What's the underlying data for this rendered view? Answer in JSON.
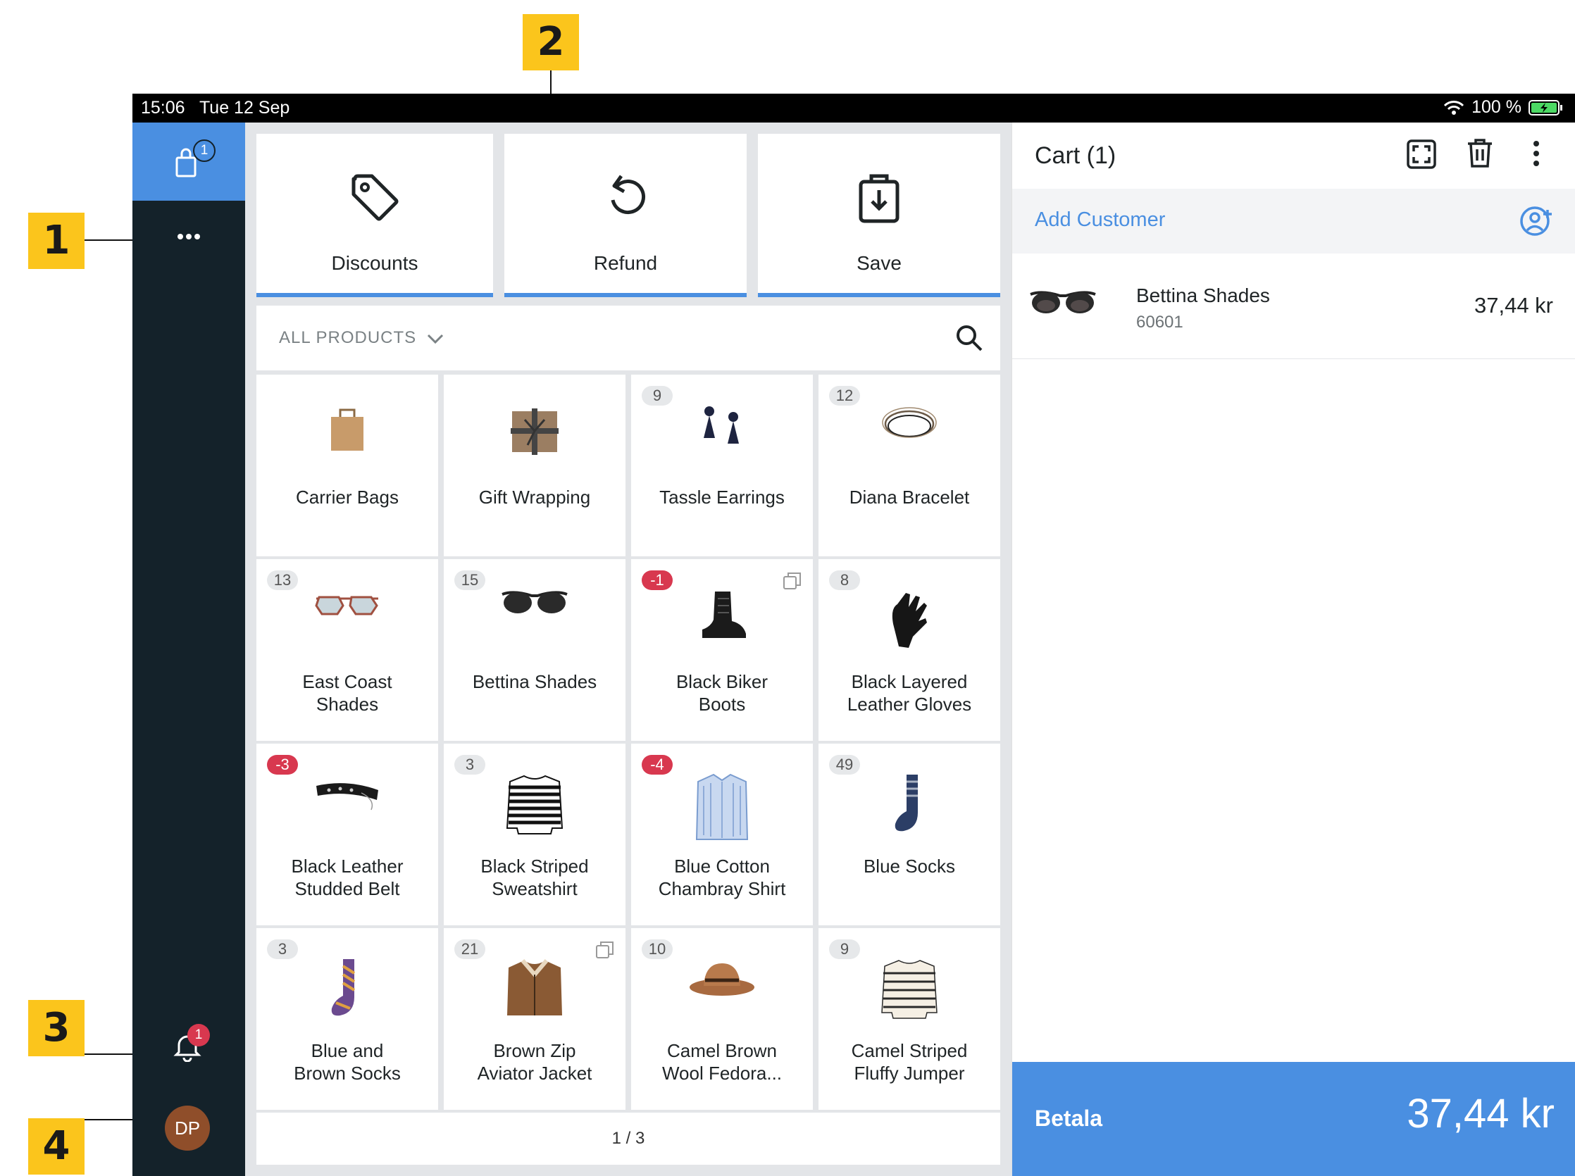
{
  "callouts": [
    "1",
    "2",
    "3",
    "4"
  ],
  "status_bar": {
    "time": "15:06",
    "date": "Tue 12 Sep",
    "battery": "100 %"
  },
  "sidebar": {
    "cart_count": "1",
    "more_icon": "more-horizontal-icon",
    "notification_count": "1",
    "avatar_initials": "DP"
  },
  "actions": [
    {
      "label": "Discounts",
      "icon": "tag-icon"
    },
    {
      "label": "Refund",
      "icon": "refund-icon"
    },
    {
      "label": "Save",
      "icon": "save-bag-icon"
    }
  ],
  "filter": {
    "label": "ALL PRODUCTS"
  },
  "products": [
    {
      "name_1": "Carrier Bags",
      "name_2": "",
      "badge": "",
      "img": "bag"
    },
    {
      "name_1": "Gift Wrapping",
      "name_2": "",
      "badge": "",
      "img": "gift"
    },
    {
      "name_1": "Tassle Earrings",
      "name_2": "",
      "badge": "9",
      "img": "earrings"
    },
    {
      "name_1": "Diana Bracelet",
      "name_2": "",
      "badge": "12",
      "img": "bracelet"
    },
    {
      "name_1": "East Coast",
      "name_2": "Shades",
      "badge": "13",
      "img": "shades2"
    },
    {
      "name_1": "Bettina Shades",
      "name_2": "",
      "badge": "15",
      "img": "shades"
    },
    {
      "name_1": "Black Biker",
      "name_2": "Boots",
      "badge": "-1",
      "img": "boot",
      "variant": true
    },
    {
      "name_1": "Black Layered",
      "name_2": "Leather Gloves",
      "badge": "8",
      "img": "gloves"
    },
    {
      "name_1": "Black Leather",
      "name_2": "Studded Belt",
      "badge": "-3",
      "img": "belt"
    },
    {
      "name_1": "Black Striped",
      "name_2": "Sweatshirt",
      "badge": "3",
      "img": "sweater"
    },
    {
      "name_1": "Blue Cotton",
      "name_2": "Chambray Shirt",
      "badge": "-4",
      "img": "shirt"
    },
    {
      "name_1": "Blue Socks",
      "name_2": "",
      "badge": "49",
      "img": "sock"
    },
    {
      "name_1": "Blue and",
      "name_2": "Brown Socks",
      "badge": "3",
      "img": "sock2"
    },
    {
      "name_1": "Brown Zip",
      "name_2": "Aviator Jacket",
      "badge": "21",
      "img": "jacket",
      "variant": true
    },
    {
      "name_1": "Camel Brown",
      "name_2": "Wool Fedora...",
      "badge": "10",
      "img": "hat"
    },
    {
      "name_1": "Camel Striped",
      "name_2": "Fluffy Jumper",
      "badge": "9",
      "img": "jumper"
    }
  ],
  "pager": "1 / 3",
  "cart": {
    "title": "Cart (1)",
    "add_customer": "Add Customer",
    "items": [
      {
        "name": "Bettina Shades",
        "sku": "60601",
        "price": "37,44 kr"
      }
    ],
    "pay_label": "Betala",
    "total": "37,44 kr"
  },
  "colors": {
    "accent": "#4a8fe1",
    "sidebar": "#14222a",
    "callout": "#fbc51c",
    "negative_badge": "#d8384f"
  }
}
